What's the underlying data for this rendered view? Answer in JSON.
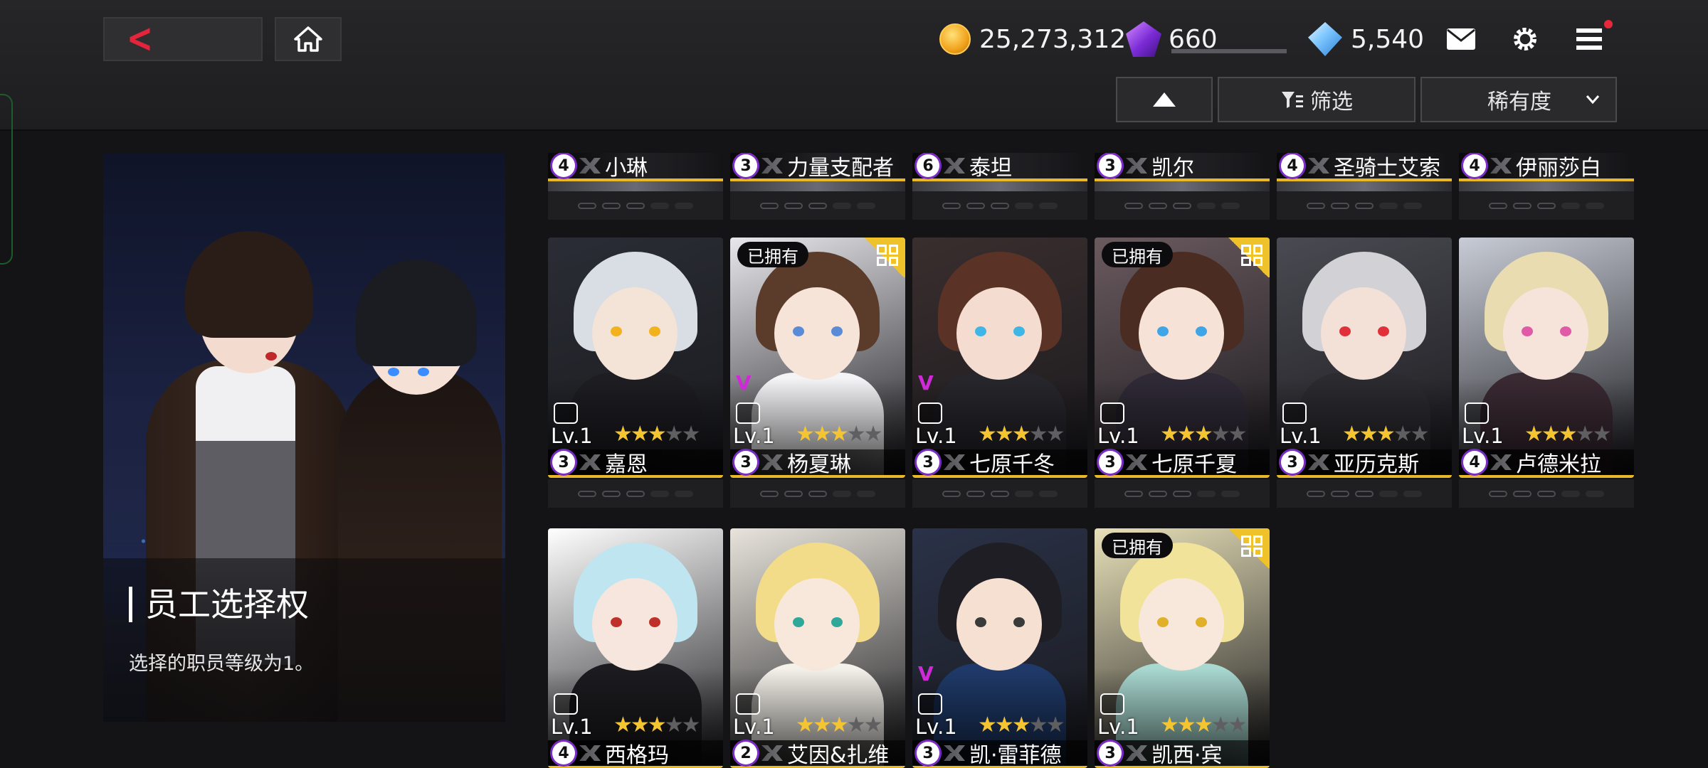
{
  "header": {
    "gold": "25,273,312",
    "crystals": "660",
    "stamina_fraction": 0,
    "gems": "5,540",
    "has_notification": true,
    "icons": [
      "back-chevron-icon",
      "home-icon",
      "gold-coin-icon",
      "purple-crystal-icon",
      "blue-diamond-icon",
      "mail-icon",
      "settings-gear-icon",
      "menu-icon"
    ]
  },
  "toolbar": {
    "filter_label": "筛选",
    "sort_label": "稀有度"
  },
  "left_panel": {
    "title": "员工选择权",
    "description": "选择的职员等级为1。"
  },
  "top_row": [
    {
      "rank": "4",
      "name": "小琳"
    },
    {
      "rank": "3",
      "name": "力量支配者"
    },
    {
      "rank": "6",
      "name": "泰坦"
    },
    {
      "rank": "3",
      "name": "凯尔"
    },
    {
      "rank": "4",
      "name": "圣骑士艾索"
    },
    {
      "rank": "4",
      "name": "伊丽莎白"
    }
  ],
  "cards": [
    {
      "name": "嘉恩",
      "rank": "3",
      "level": "Lv.1",
      "stars": 3,
      "owned": false,
      "owned_label": "",
      "v_mark": false
    },
    {
      "name": "杨夏琳",
      "rank": "3",
      "level": "Lv.1",
      "stars": 3,
      "owned": true,
      "owned_label": "已拥有",
      "v_mark": true
    },
    {
      "name": "七原千冬",
      "rank": "3",
      "level": "Lv.1",
      "stars": 3,
      "owned": false,
      "owned_label": "",
      "v_mark": true
    },
    {
      "name": "七原千夏",
      "rank": "3",
      "level": "Lv.1",
      "stars": 3,
      "owned": true,
      "owned_label": "已拥有",
      "v_mark": false
    },
    {
      "name": "亚历克斯",
      "rank": "3",
      "level": "Lv.1",
      "stars": 3,
      "owned": false,
      "owned_label": "",
      "v_mark": false
    },
    {
      "name": "卢德米拉",
      "rank": "4",
      "level": "Lv.1",
      "stars": 3,
      "owned": false,
      "owned_label": "",
      "v_mark": false
    },
    {
      "name": "西格玛",
      "rank": "4",
      "level": "Lv.1",
      "stars": 3,
      "owned": false,
      "owned_label": "",
      "v_mark": false
    },
    {
      "name": "艾因&扎维",
      "rank": "2",
      "level": "Lv.1",
      "stars": 3,
      "owned": false,
      "owned_label": "",
      "v_mark": false
    },
    {
      "name": "凯·雷菲德",
      "rank": "3",
      "level": "Lv.1",
      "stars": 3,
      "owned": false,
      "owned_label": "",
      "v_mark": true
    },
    {
      "name": "凯西·宾",
      "rank": "3",
      "level": "Lv.1",
      "stars": 3,
      "owned": true,
      "owned_label": "已拥有",
      "v_mark": false
    }
  ],
  "colors": {
    "accent_red": "#e3243b",
    "rank_purple": "#7b2cc4",
    "gold_bar": "#e9b72a",
    "star_gold": "#f5c531"
  }
}
